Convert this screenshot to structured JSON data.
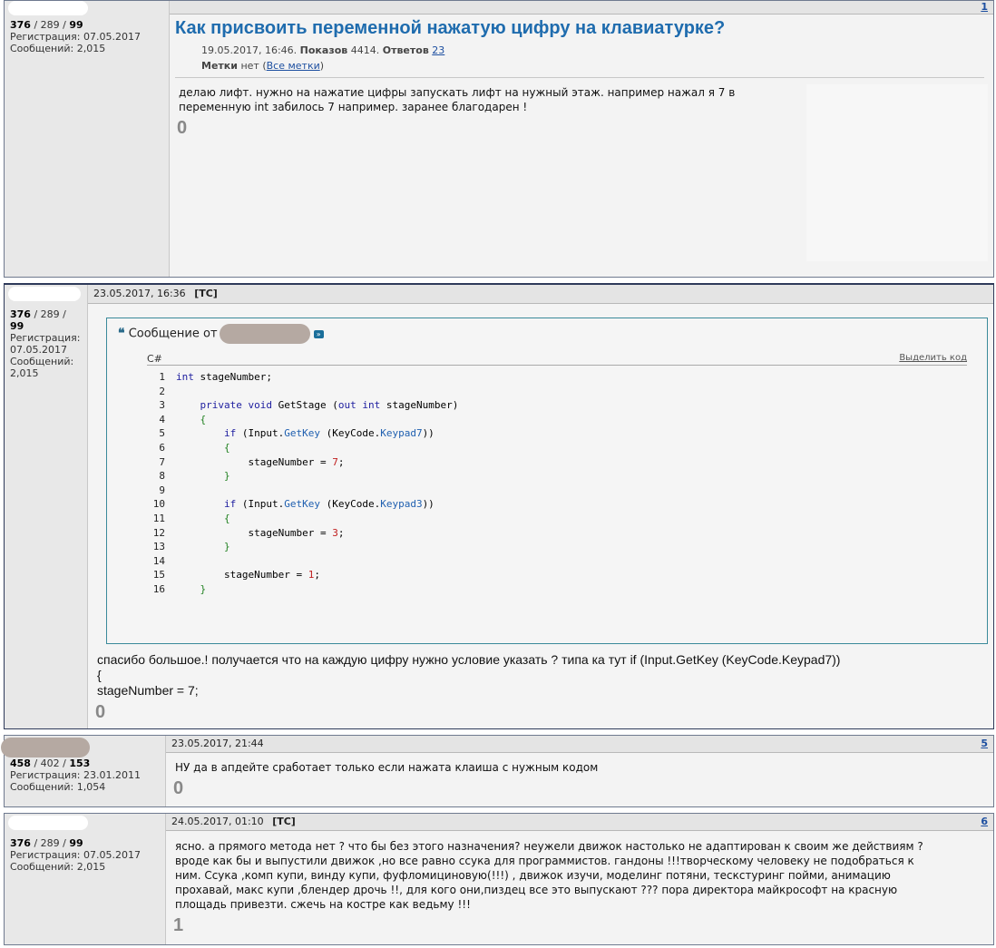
{
  "post1": {
    "header_num": "1",
    "user": {
      "stats_a": "376",
      "stats_b": "289",
      "stats_c": "99",
      "reg": "Регистрация: 07.05.2017",
      "msgs": "Сообщений: 2,015"
    },
    "title": "Как присвоить переменной нажатую цифру на клавиатурке?",
    "meta_date": "19.05.2017, 16:46.",
    "meta_views_label": "Показов",
    "meta_views": "4414.",
    "meta_answers_label": "Ответов",
    "meta_answers": "23",
    "tags_label": "Метки",
    "tags_value": "нет (",
    "tags_link": "Все метки",
    "tags_end": ")",
    "body_l1": "делаю лифт. нужно на нажатие цифры запускать лифт на нужный этаж. например нажал я 7 в",
    "body_l2": "переменную int забилось 7 например. заранее благодарен !",
    "rating": "0"
  },
  "post2": {
    "header": "23.05.2017, 16:36",
    "tc": "[ТС]",
    "user": {
      "stats_a": "376",
      "stats_b": "289",
      "stats_c": "99",
      "reg": "Регистрация:",
      "reg_date": "07.05.2017",
      "msgs": "Сообщений:",
      "msgs_val": "2,015"
    },
    "quote_label": "Сообщение от",
    "lang": "C#",
    "select_code": "Выделить код",
    "code_lines": [
      {
        "n": "1",
        "t": "int stageNumber;"
      },
      {
        "n": "2",
        "t": ""
      },
      {
        "n": "3",
        "t": "private void GetStage (out int stageNumber)"
      },
      {
        "n": "4",
        "t": "{"
      },
      {
        "n": "5",
        "t": "if (Input.GetKey (KeyCode.Keypad7))"
      },
      {
        "n": "6",
        "t": "{"
      },
      {
        "n": "7",
        "t": "stageNumber = 7;"
      },
      {
        "n": "8",
        "t": "}"
      },
      {
        "n": "9",
        "t": ""
      },
      {
        "n": "10",
        "t": "if (Input.GetKey (KeyCode.Keypad3))"
      },
      {
        "n": "11",
        "t": "{"
      },
      {
        "n": "12",
        "t": "stageNumber = 3;"
      },
      {
        "n": "13",
        "t": "}"
      },
      {
        "n": "14",
        "t": ""
      },
      {
        "n": "15",
        "t": "stageNumber = 1;"
      },
      {
        "n": "16",
        "t": "}"
      }
    ],
    "body_l1": "спасибо большое.! получается что на каждую цифру нужно условие указать ? типа ка тут if (Input.GetKey (KeyCode.Keypad7))",
    "body_l2": "{",
    "body_l3": "stageNumber = 7;",
    "rating": "0"
  },
  "post3": {
    "header": "23.05.2017, 21:44",
    "header_num": "5",
    "user": {
      "stats_a": "458",
      "stats_b": "402",
      "stats_c": "153",
      "reg": "Регистрация: 23.01.2011",
      "msgs": "Сообщений: 1,054"
    },
    "body": "НУ да в апдейте сработает только если нажата клаиша с нужным кодом",
    "rating": "0"
  },
  "post4": {
    "header": "24.05.2017, 01:10",
    "tc": "[ТС]",
    "header_num": "6",
    "user": {
      "stats_a": "376",
      "stats_b": "289",
      "stats_c": "99",
      "reg": "Регистрация: 07.05.2017",
      "msgs": "Сообщений: 2,015"
    },
    "body_lines": [
      "ясно. а прямого метода нет ? что бы без этого назначения? неужели движок настолько не адаптирован к своим же действиям ?",
      "вроде как бы и выпустили движок ,но все равно ссука для программистов. гандоны !!!творческому человеку не подобраться к",
      "ним. Ссука ,комп купи, винду купи, фуфломициновую(!!!) , движок изучи, моделинг потяни, тескстуринг пойми, анимацию",
      "прохавай, макс купи ,блендер дрочь !!, для кого они,пиздец все это выпускают ??? пора директора майкрософт на красную",
      "площадь привезти. сжечь на костре как ведьму !!!"
    ],
    "rating": "1"
  }
}
